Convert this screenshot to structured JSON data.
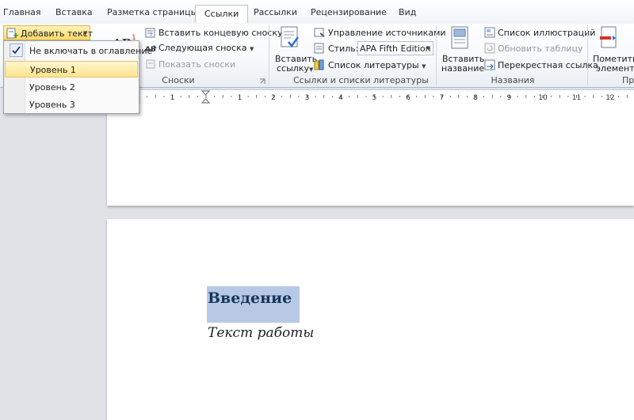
{
  "tabs": [
    {
      "label": "Главная"
    },
    {
      "label": "Вставка"
    },
    {
      "label": "Разметка страницы"
    },
    {
      "label": "Ссылки",
      "active": true
    },
    {
      "label": "Рассылки"
    },
    {
      "label": "Рецензирование"
    },
    {
      "label": "Вид"
    }
  ],
  "ribbon": {
    "toc": {
      "add_text_label": "Добавить текст"
    },
    "footnotes": {
      "group_label": "Сноски",
      "insert_endnote": "Вставить концевую сноску",
      "next_footnote": "Следующая сноска",
      "show_notes": "Показать сноски",
      "ab_label": "AB"
    },
    "citations": {
      "group_label": "Ссылки и списки литературы",
      "insert_citation_1": "Вставить",
      "insert_citation_2": "ссылку",
      "manage_sources": "Управление источниками",
      "style_label": "Стиль:",
      "style_value": "APA Fifth Edition",
      "bibliography": "Список литературы"
    },
    "captions": {
      "group_label": "Названия",
      "insert_caption_1": "Вставить",
      "insert_caption_2": "название",
      "table_of_figures": "Список иллюстраций",
      "update_table": "Обновить таблицу",
      "cross_reference": "Перекрестная ссылка"
    },
    "index": {
      "mark_entry_1": "Пометить",
      "mark_entry_2": "элемент",
      "group_label_partial": "Пр"
    }
  },
  "dropdown": {
    "items": [
      {
        "label": "Не включать в оглавление",
        "checked": true
      },
      {
        "label": "Уровень 1",
        "hover": true
      },
      {
        "label": "Уровень 2"
      },
      {
        "label": "Уровень 3"
      }
    ]
  },
  "ruler": {
    "numbers": [
      "1",
      "2",
      "1",
      "2",
      "3",
      "4",
      "5",
      "6",
      "7",
      "8",
      "9",
      "10",
      "11",
      "12"
    ]
  },
  "document": {
    "heading": "Введение",
    "body": "Текст работы"
  },
  "colors": {
    "selection": "#b7c9e4",
    "heading_color": "#17365d",
    "menu_hover": "#ffe48c"
  }
}
